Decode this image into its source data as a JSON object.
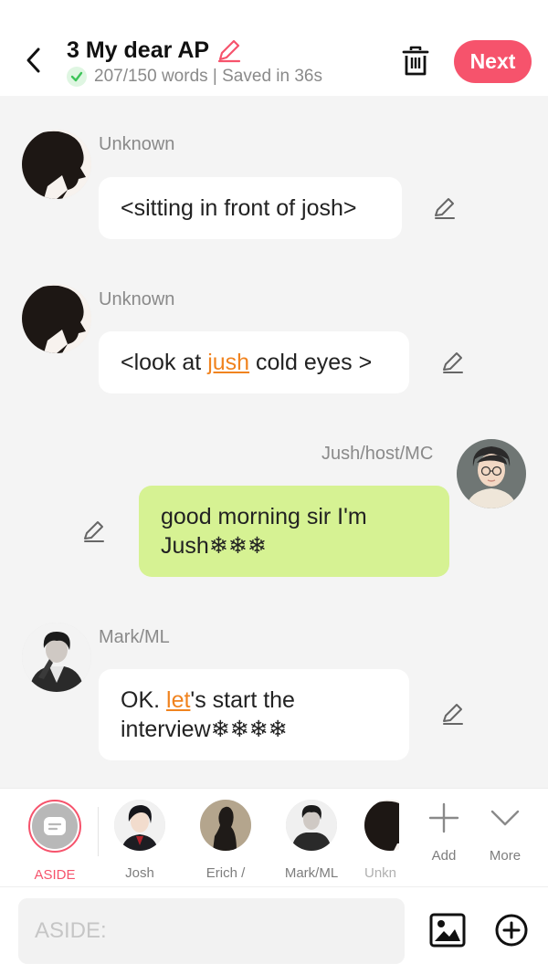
{
  "header": {
    "title": "3 My dear AP",
    "status": "207/150 words | Saved in 36s",
    "next_label": "Next"
  },
  "messages": [
    {
      "sender": "Unknown",
      "side": "left",
      "text": "<sitting in front of josh>"
    },
    {
      "sender": "Unknown",
      "side": "left",
      "text_before": "<look at ",
      "highlight": "jush",
      "text_after": " cold eyes >"
    },
    {
      "sender": "Jush/host/MC",
      "side": "right",
      "text": "good morning sir I'm Jush❄❄❄"
    },
    {
      "sender": "Mark/ML",
      "side": "left",
      "text_before": "OK. ",
      "highlight": "let",
      "text_after": "'s start the interview❄❄❄❄"
    }
  ],
  "characters": [
    {
      "label": "ASIDE",
      "selected": true
    },
    {
      "label": "Josh"
    },
    {
      "label": "Erich /"
    },
    {
      "label": "Mark/ML"
    },
    {
      "label": "Unkn"
    }
  ],
  "tools": [
    {
      "label": "Add",
      "icon": "plus-icon"
    },
    {
      "label": "More",
      "icon": "chevron-down-icon"
    }
  ],
  "composer": {
    "placeholder": "ASIDE:"
  },
  "colors": {
    "accent": "#f6536c",
    "highlight": "#f0831f",
    "green_bubble": "#d6f293",
    "saved_check": "#3ec45a"
  }
}
